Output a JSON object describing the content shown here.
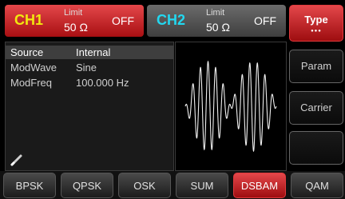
{
  "ch1": {
    "name": "CH1",
    "limit_label": "Limit",
    "impedance": "50 Ω",
    "state": "OFF"
  },
  "ch2": {
    "name": "CH2",
    "limit_label": "Limit",
    "impedance": "50 Ω",
    "state": "OFF"
  },
  "params": [
    {
      "label": "Source",
      "value": "Internal"
    },
    {
      "label": "ModWave",
      "value": "Sine"
    },
    {
      "label": "ModFreq",
      "value": "100.000 Hz"
    }
  ],
  "softkeys": {
    "type": "Type",
    "type_dots": "●●●",
    "param": "Param",
    "carrier": "Carrier"
  },
  "modulations": [
    "BPSK",
    "QPSK",
    "OSK",
    "SUM",
    "DSBAM",
    "QAM"
  ],
  "active_modulation": "DSBAM",
  "colors": {
    "accent_red": "#d42a2d",
    "ch1_yellow": "#f2e70f",
    "ch2_cyan": "#22d8f0"
  },
  "icons": {
    "edit": "pencil-icon"
  }
}
